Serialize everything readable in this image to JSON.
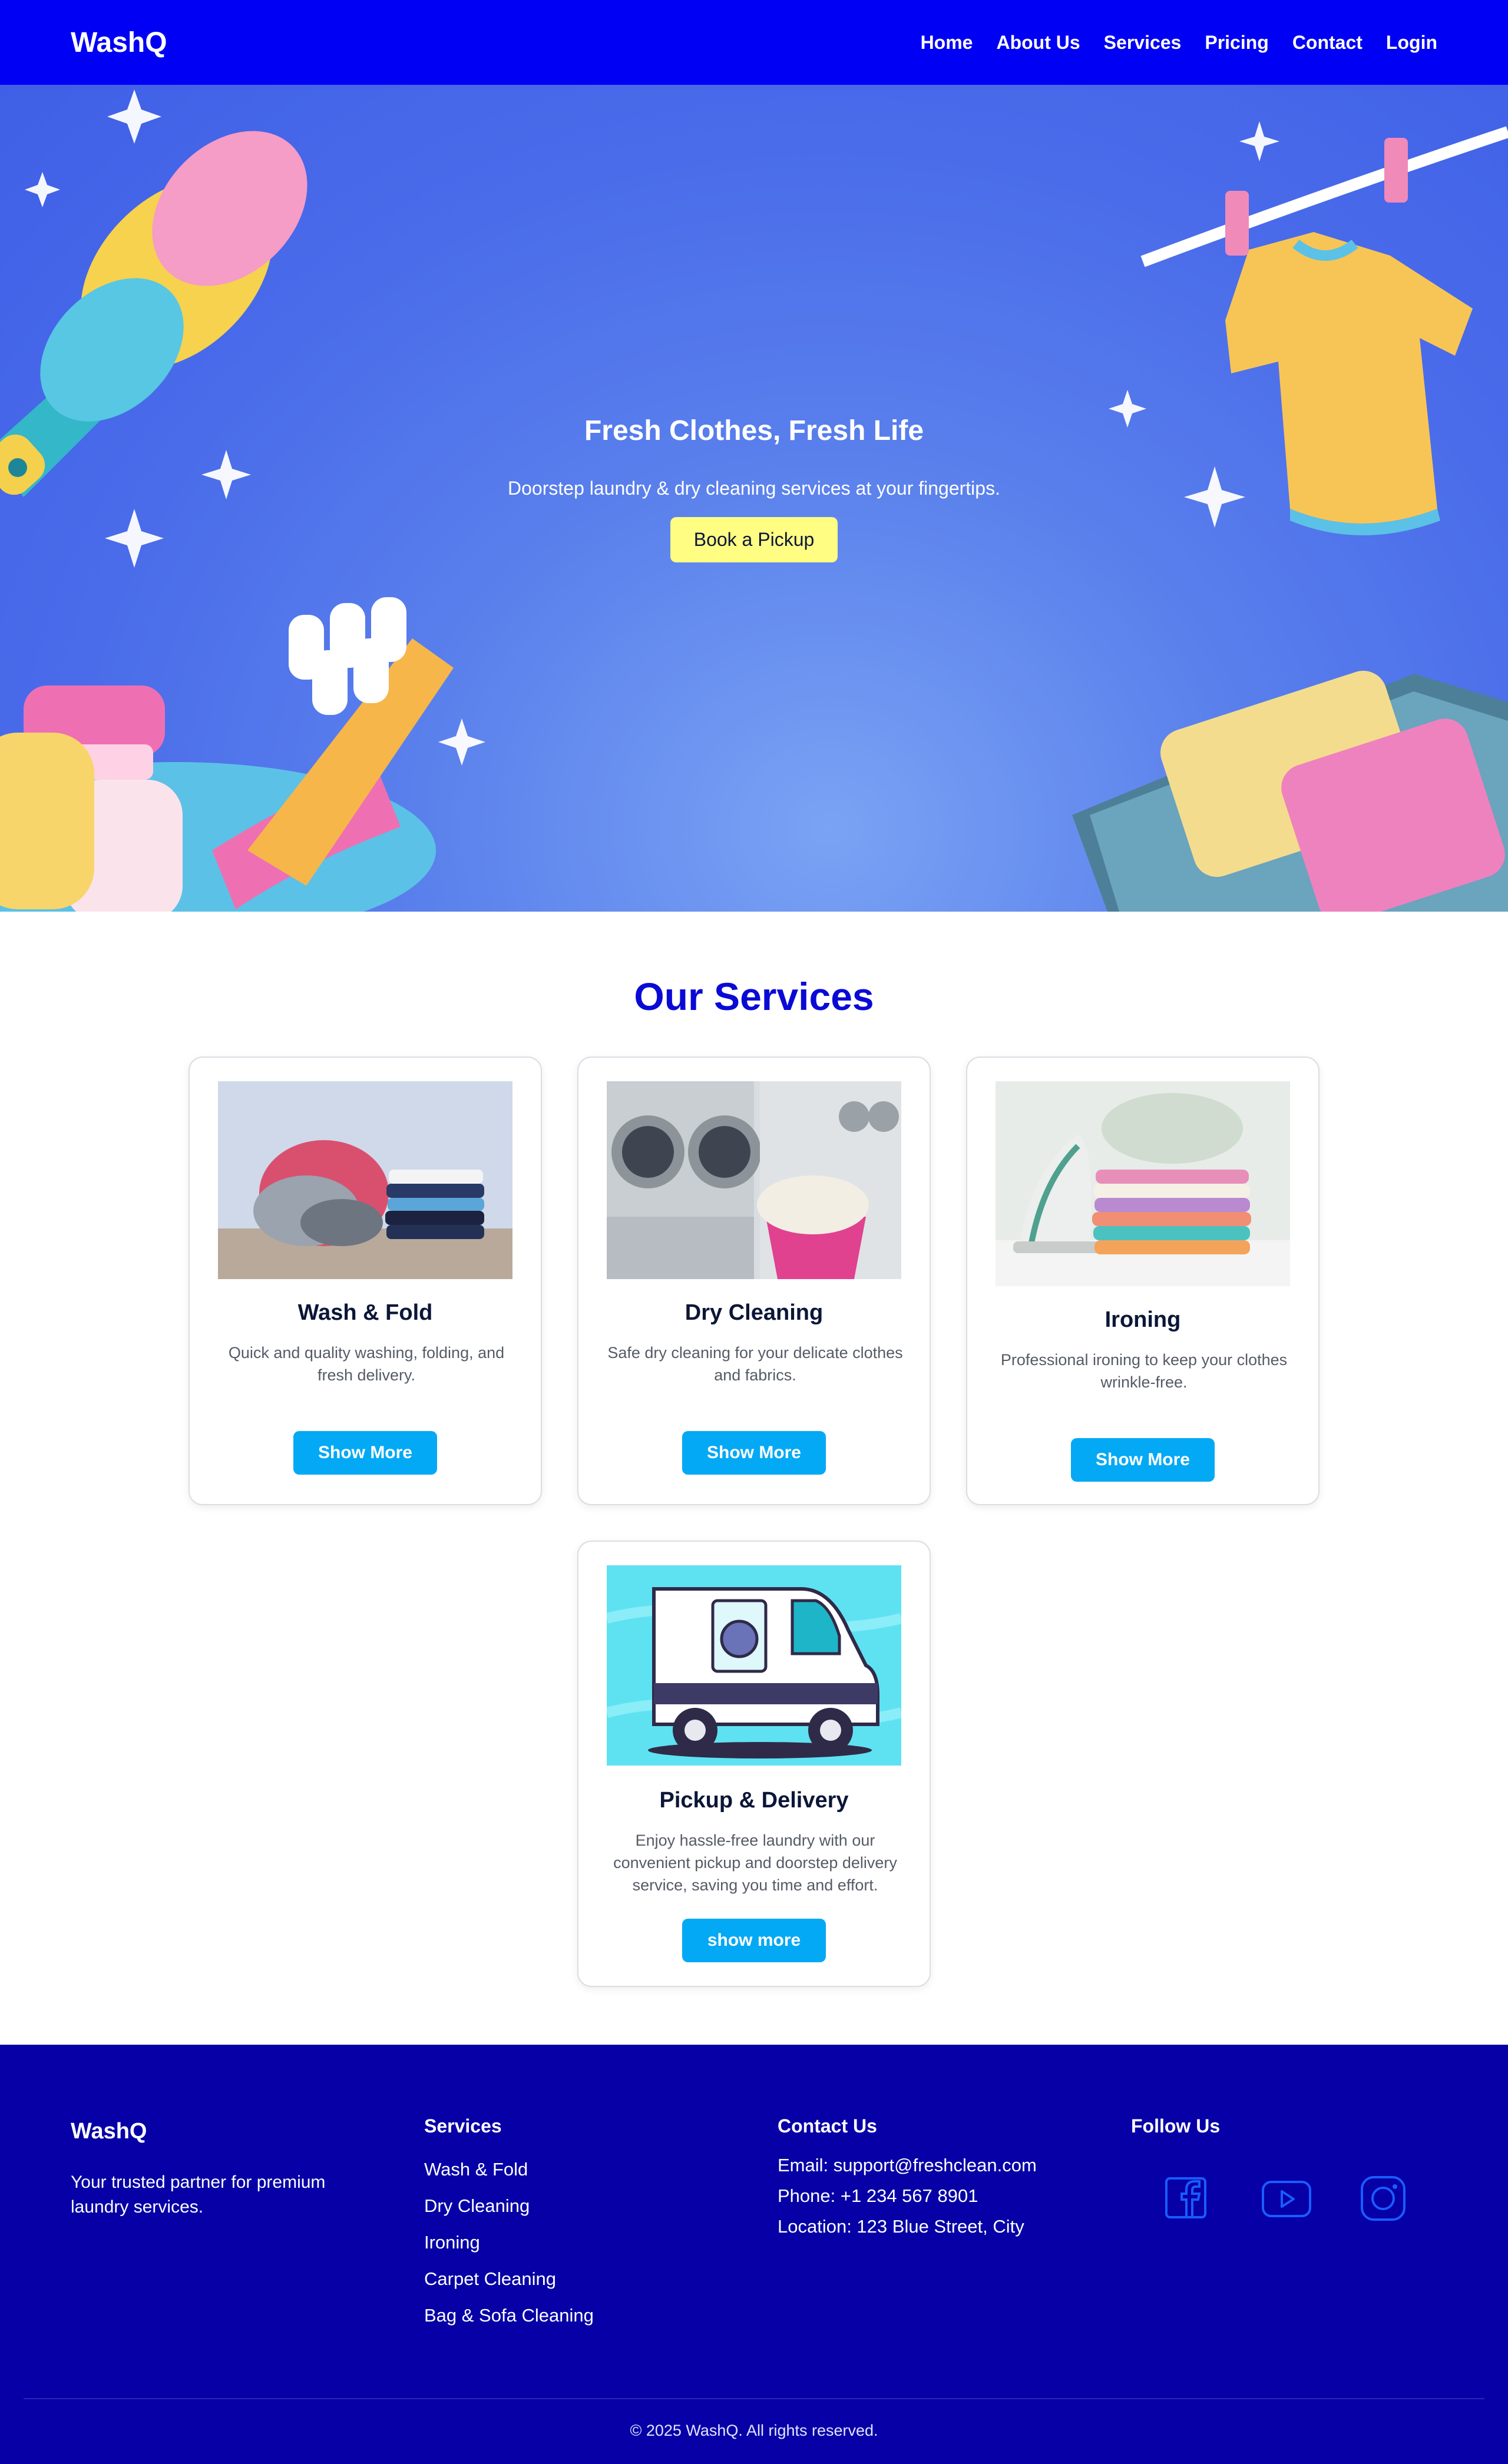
{
  "nav": {
    "brand": "WashQ",
    "links": [
      "Home",
      "About Us",
      "Services",
      "Pricing",
      "Contact",
      "Login"
    ]
  },
  "hero": {
    "title": "Fresh Clothes, Fresh Life",
    "subtitle": "Doorstep laundry & dry cleaning services at your fingertips.",
    "cta": "Book a Pickup"
  },
  "services": {
    "title": "Our Services",
    "cards": [
      {
        "title": "Wash & Fold",
        "desc": "Quick and quality washing, folding, and fresh delivery.",
        "button": "Show More",
        "image": "folded-laundry-image"
      },
      {
        "title": "Dry Cleaning",
        "desc": "Safe dry cleaning for your delicate clothes and fabrics.",
        "button": "Show More",
        "image": "laundromat-image"
      },
      {
        "title": "Ironing",
        "desc": "Professional ironing to keep your clothes wrinkle-free.",
        "button": "Show More",
        "image": "iron-and-clothes-image"
      },
      {
        "title": "Pickup & Delivery",
        "desc": "Enjoy hassle-free laundry with our convenient pickup and doorstep delivery service, saving you time and effort.",
        "button": "show more",
        "image": "laundry-van-image"
      }
    ]
  },
  "footer": {
    "brand": "WashQ",
    "tagline": "Your trusted partner for premium laundry services.",
    "services_heading": "Services",
    "services": [
      "Wash & Fold",
      "Dry Cleaning",
      "Ironing",
      "Carpet Cleaning",
      "Bag & Sofa Cleaning"
    ],
    "contact_heading": "Contact Us",
    "contact": [
      "Email: support@freshclean.com",
      "Phone: +1 234 567 8901",
      "Location: 123 Blue Street, City"
    ],
    "follow_heading": "Follow Us",
    "socials": [
      "facebook-icon",
      "youtube-icon",
      "instagram-icon"
    ],
    "copyright": "© 2025 WashQ. All rights reserved."
  },
  "colors": {
    "nav_bg": "#0000f5",
    "hero_bg": "#4a6cea",
    "cta_bg": "#fffd82",
    "accent_title": "#0a0ad6",
    "button_bg": "#03a9f4",
    "footer_bg": "#0600a6"
  }
}
